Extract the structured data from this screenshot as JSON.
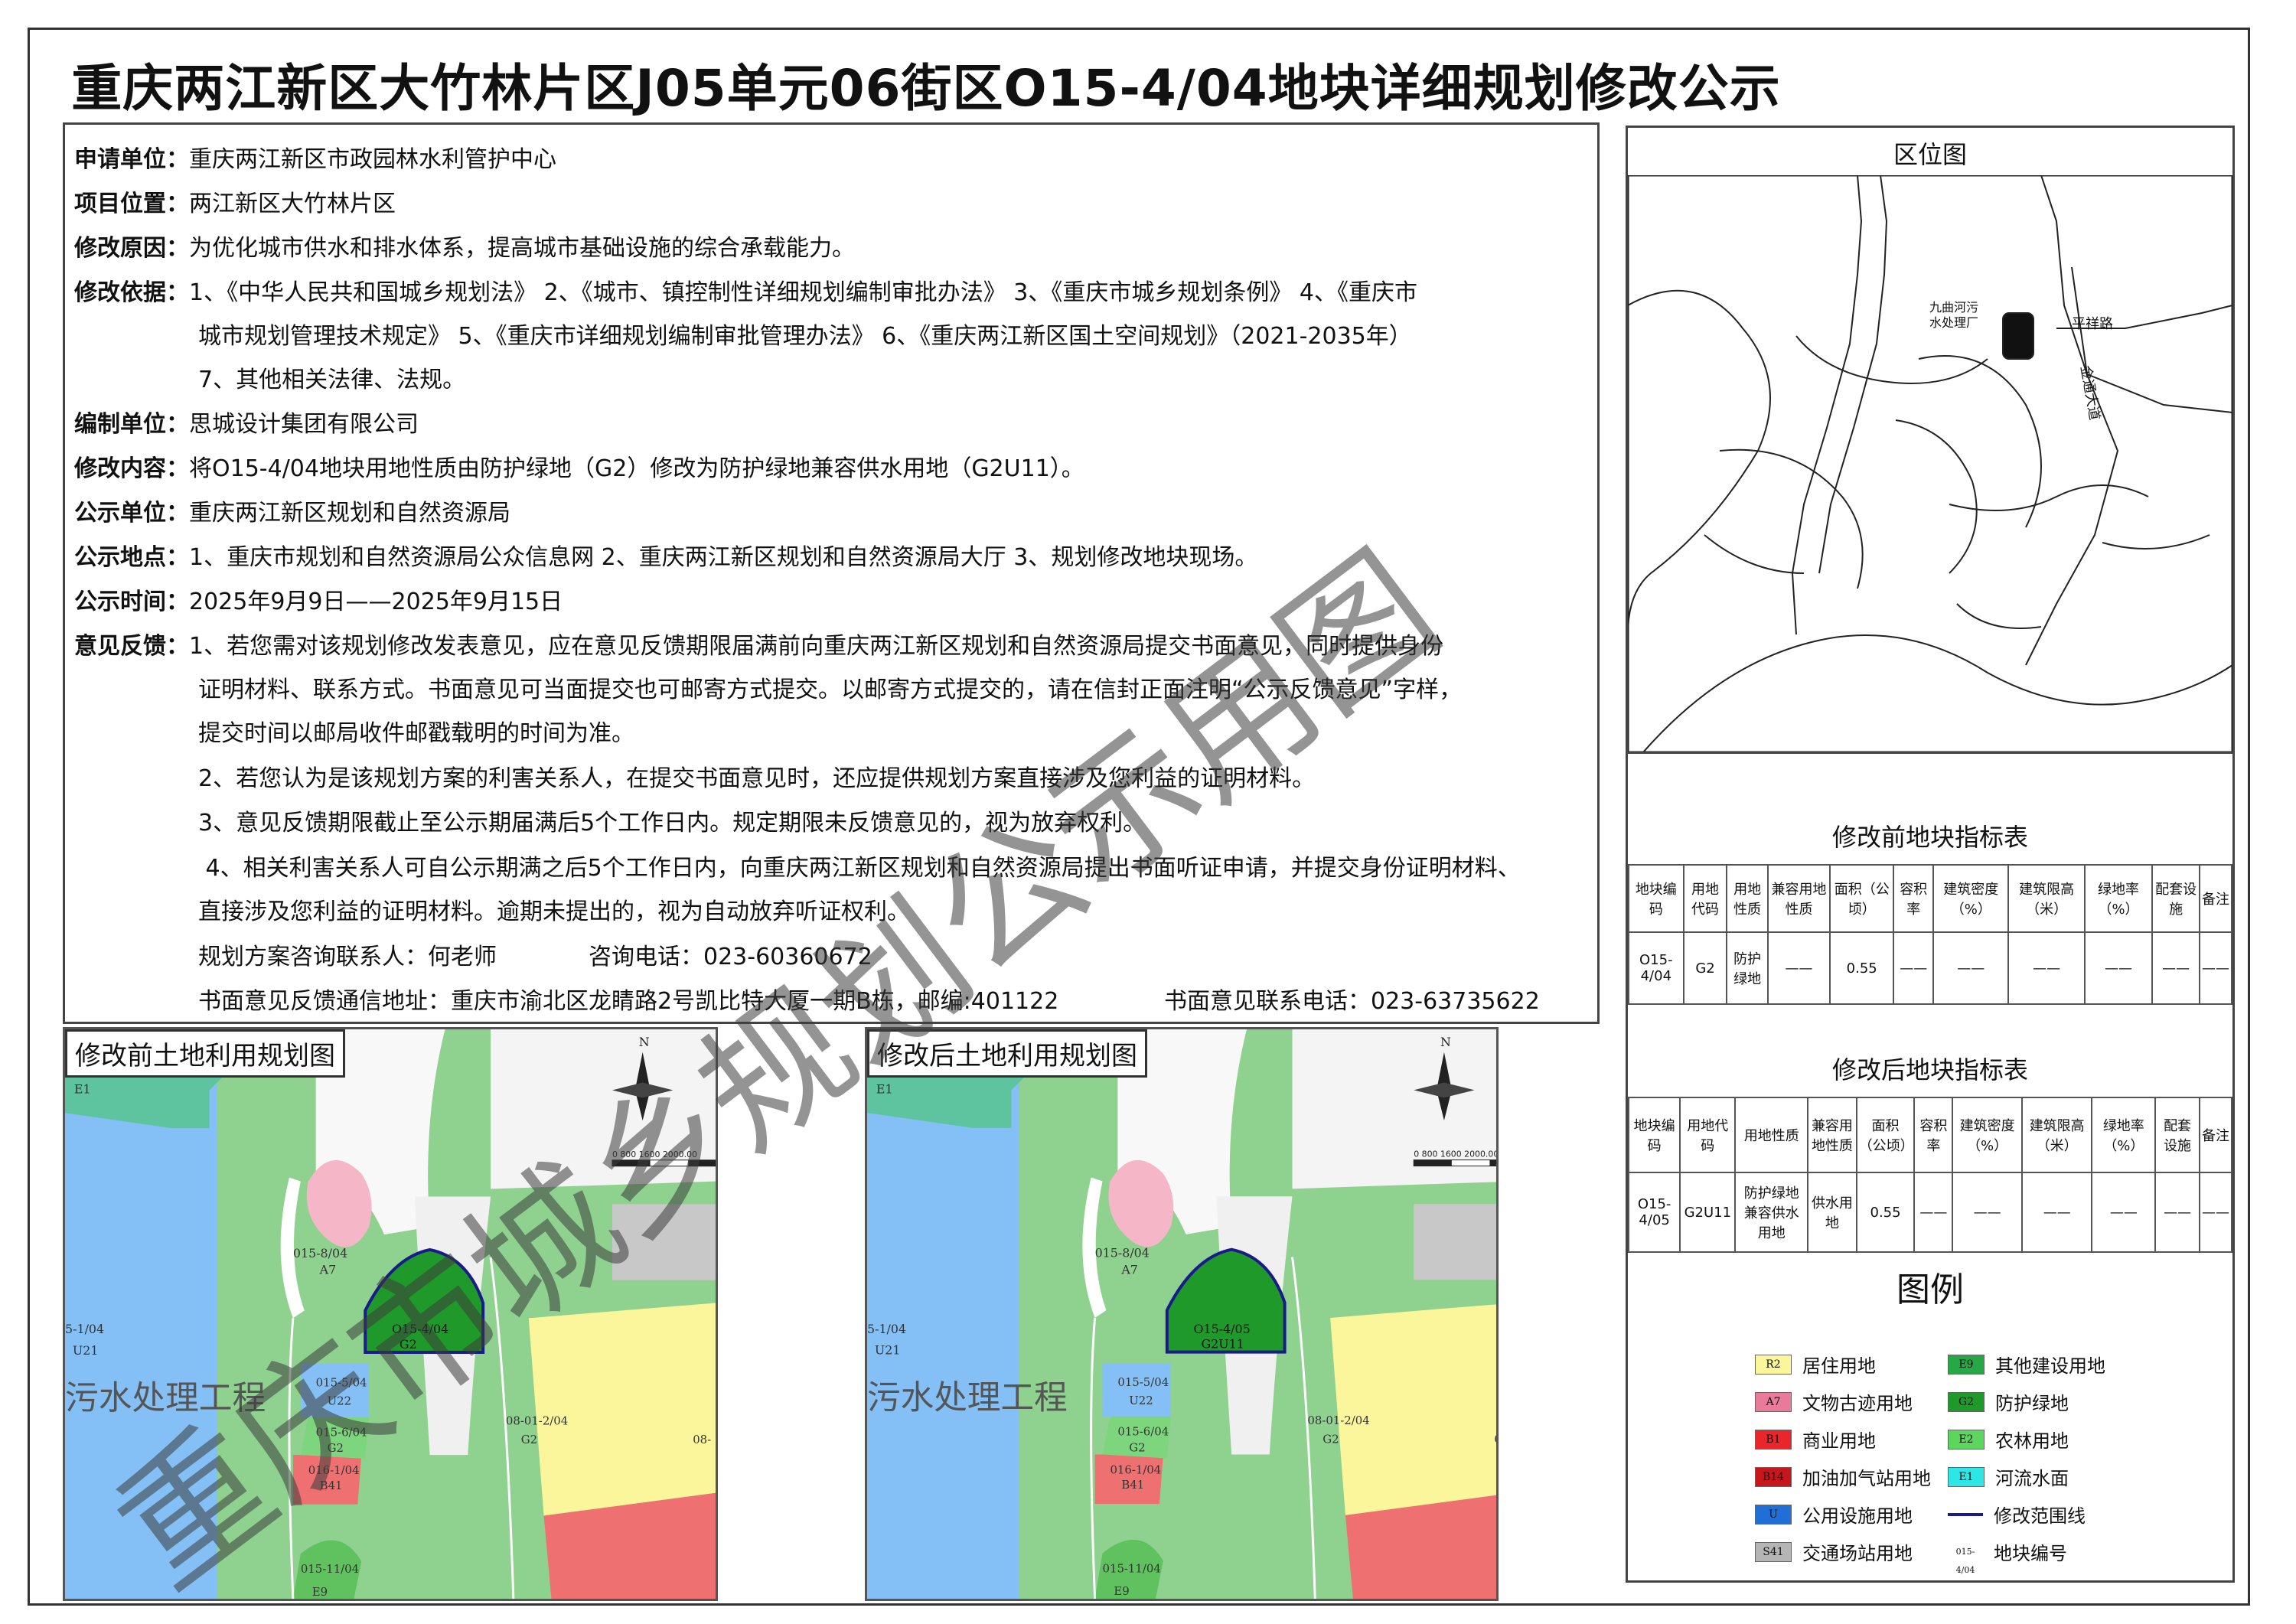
{
  "title": "重庆两江新区大竹林片区J05单元06街区O15-4/04地块详细规划修改公示",
  "info": {
    "applicant": {
      "k": "申请单位：",
      "v": "重庆两江新区市政园林水利管护中心"
    },
    "location": {
      "k": "项目位置：",
      "v": "两江新区大竹林片区"
    },
    "reason": {
      "k": "修改原因：",
      "v": "为优化城市供水和排水体系，提高城市基础设施的综合承载能力。"
    },
    "basis": {
      "k": "修改依据：",
      "l1": "1、《中华人民共和国城乡规划法》 2、《城市、镇控制性详细规划编制审批办法》 3、《重庆市城乡规划条例》 4、《重庆市",
      "l2": "城市规划管理技术规定》 5、《重庆市详细规划编制审批管理办法》 6、《重庆两江新区国土空间规划》（2021-2035年）",
      "l3": "7、其他相关法律、法规。"
    },
    "compiler": {
      "k": "编制单位：",
      "v": "思城设计集团有限公司"
    },
    "content": {
      "k": "修改内容：",
      "v": "将O15-4/04地块用地性质由防护绿地（G2）修改为防护绿地兼容供水用地（G2U11）。"
    },
    "publisher": {
      "k": "公示单位：",
      "v": "重庆两江新区规划和自然资源局"
    },
    "place": {
      "k": "公示地点：",
      "v": "1、重庆市规划和自然资源局公众信息网 2、重庆两江新区规划和自然资源局大厅 3、规划修改地块现场。"
    },
    "time": {
      "k": "公示时间：",
      "v": "2025年9月9日——2025年9月15日"
    },
    "feedback": {
      "k": "意见反馈：",
      "l1": "1、若您需对该规划修改发表意见，应在意见反馈期限届满前向重庆两江新区规划和自然资源局提交书面意见，同时提供身份",
      "l2": "证明材料、联系方式。书面意见可当面提交也可邮寄方式提交。以邮寄方式提交的，请在信封正面注明“公示反馈意见”字样，",
      "l3": "提交时间以邮局收件邮戳载明的时间为准。",
      "l4": "2、若您认为是该规划方案的利害关系人，在提交书面意见时，还应提供规划方案直接涉及您利益的证明材料。",
      "l5": "3、意见反馈期限截止至公示期届满后5个工作日内。规定期限未反馈意见的，视为放弃权利。",
      "l6": " 4、相关利害关系人可自公示期满之后5个工作日内，向重庆两江新区规划和自然资源局提出书面听证申请，并提交身份证明材料、",
      "l7": "直接涉及您利益的证明材料。逾期未提出的，视为自动放弃听证权利。",
      "l8a": "规划方案咨询联系人：何老师",
      "l8b": "咨询电话：023-60360672",
      "l9a": "书面意见反馈通信地址：重庆市渝北区龙睛路2号凯比特大厦一期B栋，邮编:401122",
      "l9b": "书面意见联系电话：023-63735622"
    }
  },
  "location_map": {
    "title": "区位图",
    "plant": "九曲河污\n水处理厂",
    "road1": "平祥路",
    "road2": "金通大道"
  },
  "before_table": {
    "title": "修改前地块指标表",
    "headers": [
      "地块编码",
      "用地代码",
      "用地性质",
      "兼容用地性质",
      "面积（公顷）",
      "容积率",
      "建筑密度（%）",
      "建筑限高（米）",
      "绿地率（%）",
      "配套设施",
      "备注"
    ],
    "row": [
      "O15-4/04",
      "G2",
      "防护绿地",
      "——",
      "0.55",
      "——",
      "——",
      "——",
      "——",
      "——",
      "——"
    ]
  },
  "after_table": {
    "title": "修改后地块指标表",
    "headers": [
      "地块编码",
      "用地代码",
      "用地性质",
      "兼容用地性质",
      "面积（公顷）",
      "容积率",
      "建筑密度（%）",
      "建筑限高（米）",
      "绿地率（%）",
      "配套设施",
      "备注"
    ],
    "row": [
      "O15-4/05",
      "G2U11",
      "防护绿地兼容供水用地",
      "供水用地",
      "0.55",
      "——",
      "——",
      "——",
      "——",
      "——",
      "——"
    ]
  },
  "legend": {
    "title": "图例",
    "items": [
      {
        "code": "R2",
        "label": "居住用地",
        "color": "#fbf59b"
      },
      {
        "code": "E9",
        "label": "其他建设用地",
        "color": "#28a745"
      },
      {
        "code": "A7",
        "label": "文物古迹用地",
        "color": "#e87a9a"
      },
      {
        "code": "G2",
        "label": "防护绿地",
        "color": "#1f9a2a"
      },
      {
        "code": "B1",
        "label": "商业用地",
        "color": "#e8262b"
      },
      {
        "code": "E2",
        "label": "农林用地",
        "color": "#5cd65c"
      },
      {
        "code": "B14",
        "label": "加油加气站用地",
        "color": "#c8161d"
      },
      {
        "code": "E1",
        "label": "河流水面",
        "color": "#2ee6e6"
      },
      {
        "code": "U",
        "label": "公用设施用地",
        "color": "#1f6fd6"
      },
      {
        "code": "",
        "label": "修改范围线",
        "color": "#1a1a8a"
      },
      {
        "code": "S41",
        "label": "交通场站用地",
        "color": "#b5b5b5"
      },
      {
        "code": "015-4/04",
        "label": "地块编号",
        "color": "#ffffff"
      }
    ]
  },
  "before_map": {
    "caption": "修改前土地利用规划图",
    "parcel": "O15-4/04",
    "parcel_code": "G2"
  },
  "after_map": {
    "caption": "修改后土地利用规划图",
    "parcel": "O15-4/05",
    "parcel_code": "G2U11"
  },
  "map_labels": {
    "e1": "E1",
    "a7id": "015-8/04",
    "a7": "A7",
    "u21id": "5-1/04",
    "u21": "U21",
    "water": "污水处理工程",
    "u22id": "015-5/04",
    "u22": "U22",
    "g2aid": "015-6/04",
    "g2a": "G2",
    "b41id": "016-1/04",
    "b41": "B41",
    "e9id": "015-11/04",
    "e9": "E9",
    "g2bid": "08-01-2/04",
    "g2b": "G2",
    "g2c": "08-",
    "north": "N",
    "scale": "0 800 1600 2000.00"
  },
  "watermark": "重庆市城乡规划公示用图"
}
